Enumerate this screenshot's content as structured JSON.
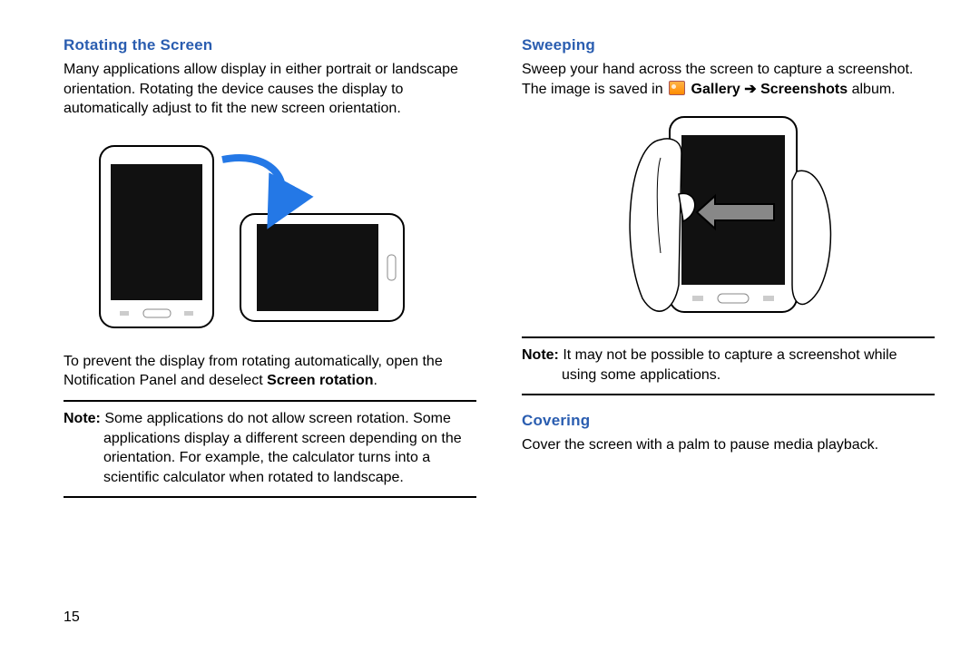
{
  "left": {
    "heading": "Rotating the Screen",
    "para1": "Many applications allow display in either portrait or landscape orientation. Rotating the device causes the display to automatically adjust to fit the new screen orientation.",
    "para2_a": "To prevent the display from rotating automatically, open the Notification Panel and deselect ",
    "para2_bold": "Screen rotation",
    "para2_b": ".",
    "note_label": "Note:",
    "note_first": " Some applications do not allow screen rotation. Some",
    "note_rest": "applications display a different screen depending on the orientation. For example, the calculator turns into a scientific calculator when rotated to landscape."
  },
  "right": {
    "heading1": "Sweeping",
    "p1_a": "Sweep your hand across the screen to capture a screenshot. The image is saved in ",
    "p1_gallery": "Gallery",
    "p1_arrow": " ➔ ",
    "p1_screens": "Screenshots",
    "p1_b": " album.",
    "note_label": "Note:",
    "note_first": " It may not be possible to capture a screenshot while",
    "note_rest": "using some applications.",
    "heading2": "Covering",
    "p2": "Cover the screen with a palm to pause media playback."
  },
  "page_number": "15"
}
